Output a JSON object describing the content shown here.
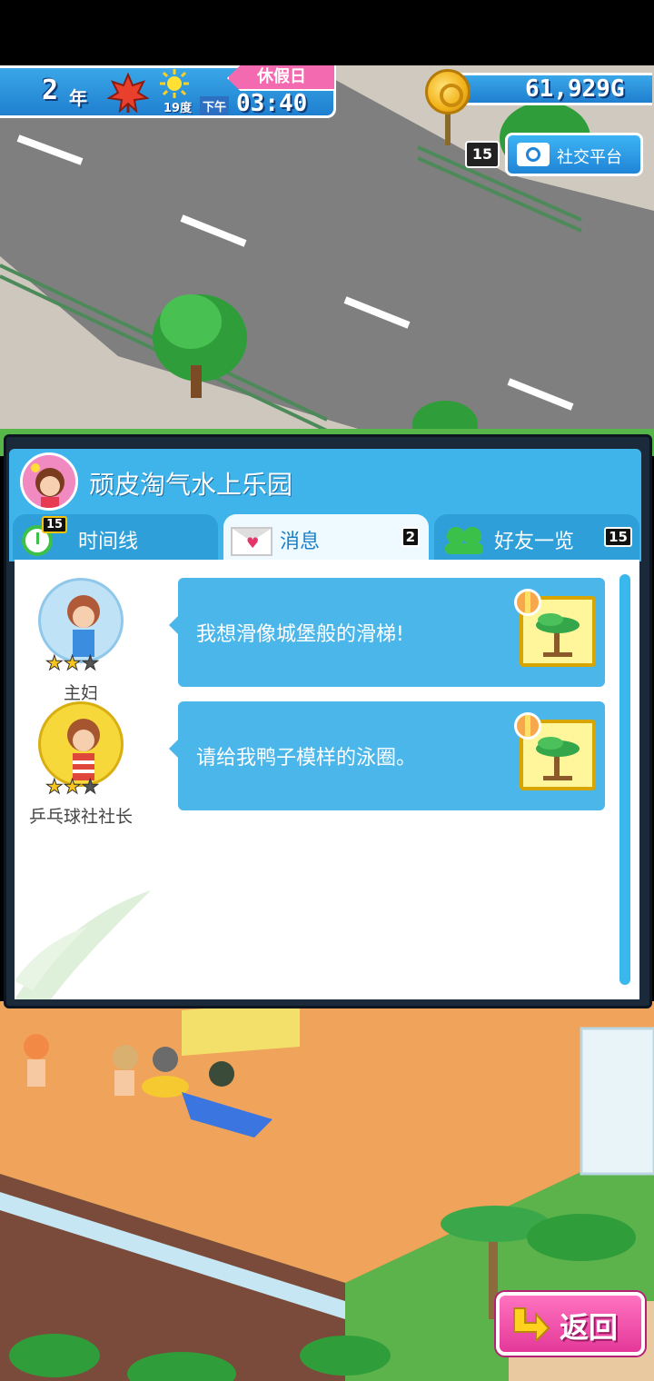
{
  "hud": {
    "year": "2",
    "year_unit": "年",
    "season_icon": "maple-leaf-icon",
    "weather_icon": "sun-icon",
    "temperature": "19度",
    "holiday": "休假日",
    "ampm": "下午",
    "time": "03:40",
    "money": "61,929G"
  },
  "social": {
    "badge": "15",
    "label": "社交平台"
  },
  "panel": {
    "park_name": "顽皮淘气水上乐园",
    "tabs": [
      {
        "label": "时间线",
        "count": "15",
        "icon": "clock-icon"
      },
      {
        "label": "消息",
        "count": "2",
        "icon": "mail-icon"
      },
      {
        "label": "好友一览",
        "count": "15",
        "icon": "friends-icon"
      }
    ],
    "active_tab": "消息"
  },
  "messages": [
    {
      "role": "主妇",
      "stars": 2,
      "max_stars": 3,
      "text": "我想滑像城堡般的滑梯!",
      "reward_icon": "palm-tree-icon"
    },
    {
      "role": "乒乓球社社长",
      "stars": 2,
      "max_stars": 3,
      "text": "请给我鸭子模样的泳圈。",
      "reward_icon": "palm-tree-icon"
    }
  ],
  "back": {
    "label": "返回"
  },
  "colors": {
    "accent_blue": "#3eb4ea",
    "back_pink": "#e43899",
    "star_gold": "#f6c51d"
  }
}
